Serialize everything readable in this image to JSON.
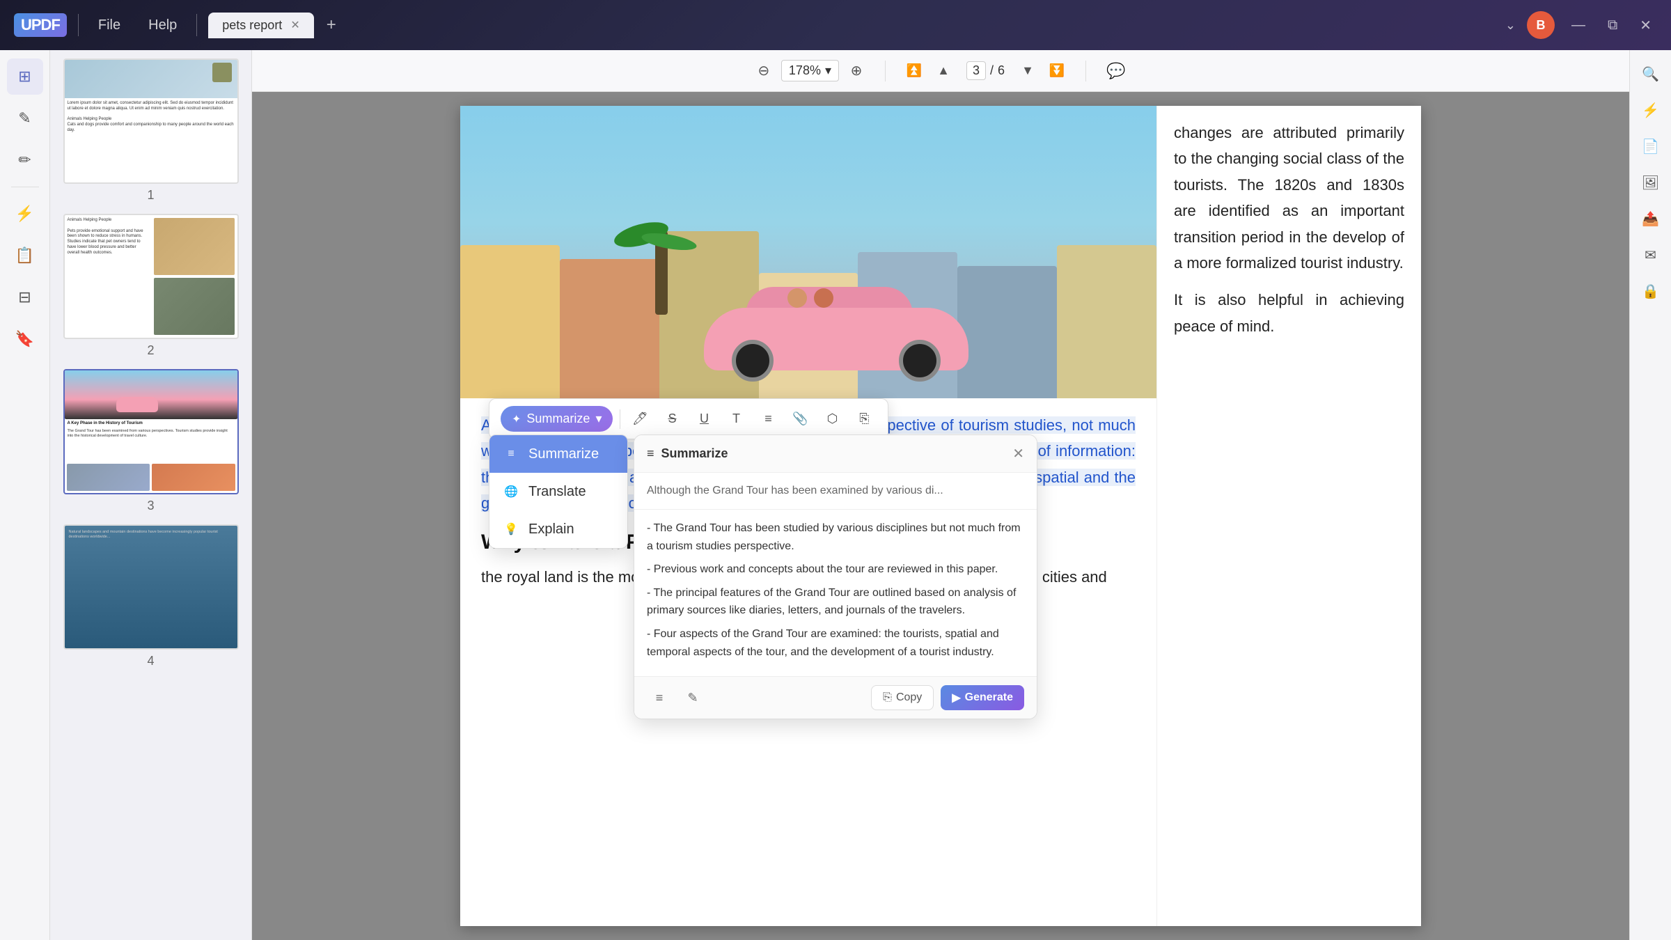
{
  "app": {
    "logo": "UPDF",
    "nav_file": "File",
    "nav_help": "Help",
    "tab_name": "pets report",
    "tab_add": "+",
    "avatar_initial": "B",
    "win_minimize": "—",
    "win_maximize": "⧉",
    "win_close": "✕"
  },
  "toolbar": {
    "zoom_out": "⊖",
    "zoom_level": "178%",
    "zoom_dropdown": "▾",
    "zoom_in": "⊕",
    "first_page": "⏫",
    "prev_page": "⬆",
    "page_current": "3",
    "page_sep": "/",
    "page_total": "6",
    "next_page": "⬇",
    "last_page": "⏬",
    "comment": "💬",
    "search": "🔍"
  },
  "left_tools": [
    {
      "icon": "☰",
      "name": "pages-tool",
      "active": true
    },
    {
      "icon": "✎",
      "name": "edit-tool",
      "active": false
    },
    {
      "icon": "✏",
      "name": "annotate-tool",
      "active": false
    },
    {
      "icon": "⚡",
      "name": "convert-tool",
      "active": false
    },
    {
      "icon": "📋",
      "name": "organize-tool",
      "active": false
    },
    {
      "icon": "🔖",
      "name": "bookmark-tool",
      "active": false
    }
  ],
  "right_tools": [
    {
      "icon": "⚡",
      "name": "r-tool-1"
    },
    {
      "icon": "📄",
      "name": "r-tool-2"
    },
    {
      "icon": "🖼",
      "name": "r-tool-3"
    },
    {
      "icon": "📤",
      "name": "r-tool-4"
    },
    {
      "icon": "✉",
      "name": "r-tool-5"
    },
    {
      "icon": "🔒",
      "name": "r-tool-6"
    }
  ],
  "thumbnails": [
    {
      "label": "1"
    },
    {
      "label": "2"
    },
    {
      "label": "3",
      "selected": true
    },
    {
      "label": "4"
    }
  ],
  "document": {
    "right_text_1": "changes are attributed primarily to the changing social class of the tourists. The 1820s and 1830s are identified as an important transition period in the develop of a more formalized tourist industry.",
    "right_text_2": "It is also helpful in achieving peace of mind.",
    "main_paragraph": "Although the Grand Tour has been examined from the perspective of tourism studies, not much work and concepts about the tour and then other aspects of the primary sources of information: the principal features aspects of the Grand Tour are then examined: the tourists, spatial and the gradual development of a tourist industry.",
    "heading": "Why to Take a Plant Tour",
    "sub_paragraph": "the royal land is the most sought after tourist destination in India. With its historical cities and"
  },
  "ai_toolbar": {
    "summarize_label": "Summarize",
    "dropdown_arrow": "▾",
    "highlight_icon": "🖊",
    "strikethrough_icon": "S̶",
    "underline_icon": "U̲",
    "text_icon": "T",
    "list_icon": "≡",
    "bookmark_icon": "🔖",
    "stamp_icon": "⬡",
    "copy_icon": "⎘"
  },
  "dropdown_menu": {
    "items": [
      {
        "icon": "≡",
        "label": "Summarize",
        "active": true
      },
      {
        "icon": "🌐",
        "label": "Translate",
        "active": false
      },
      {
        "icon": "💡",
        "label": "Explain",
        "active": false
      }
    ]
  },
  "summarize_panel": {
    "title": "Summarize",
    "close": "✕",
    "input_preview": "Although the Grand Tour has been examined by various di...",
    "bullets": [
      "- The Grand Tour has been studied by various disciplines but not much from a tourism studies perspective.",
      "- Previous work and concepts about the tour are reviewed in this paper.",
      "- The principal features of the Grand Tour are outlined based on analysis of primary sources like diaries, letters, and journals of the travelers.",
      "- Four aspects of the Grand Tour are examined: the tourists, spatial and temporal aspects of the tour, and the development of a tourist industry."
    ],
    "copy_label": "Copy",
    "generate_label": "Generate",
    "generate_icon": "▶"
  }
}
